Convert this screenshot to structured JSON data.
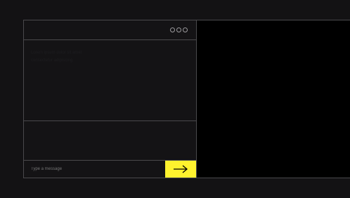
{
  "header": {
    "menu_icon": "more-dots-icon"
  },
  "content": {
    "lines": [
      "Lorem ipsum dolor sit amet",
      "consectetur adipiscing"
    ]
  },
  "input": {
    "placeholder": "Type a message"
  },
  "submit": {
    "icon": "arrow-right-icon",
    "color": "#fff22e"
  },
  "colors": {
    "background": "#131214",
    "border": "#4a494c",
    "preview": "#000000",
    "accent": "#fff22e"
  }
}
